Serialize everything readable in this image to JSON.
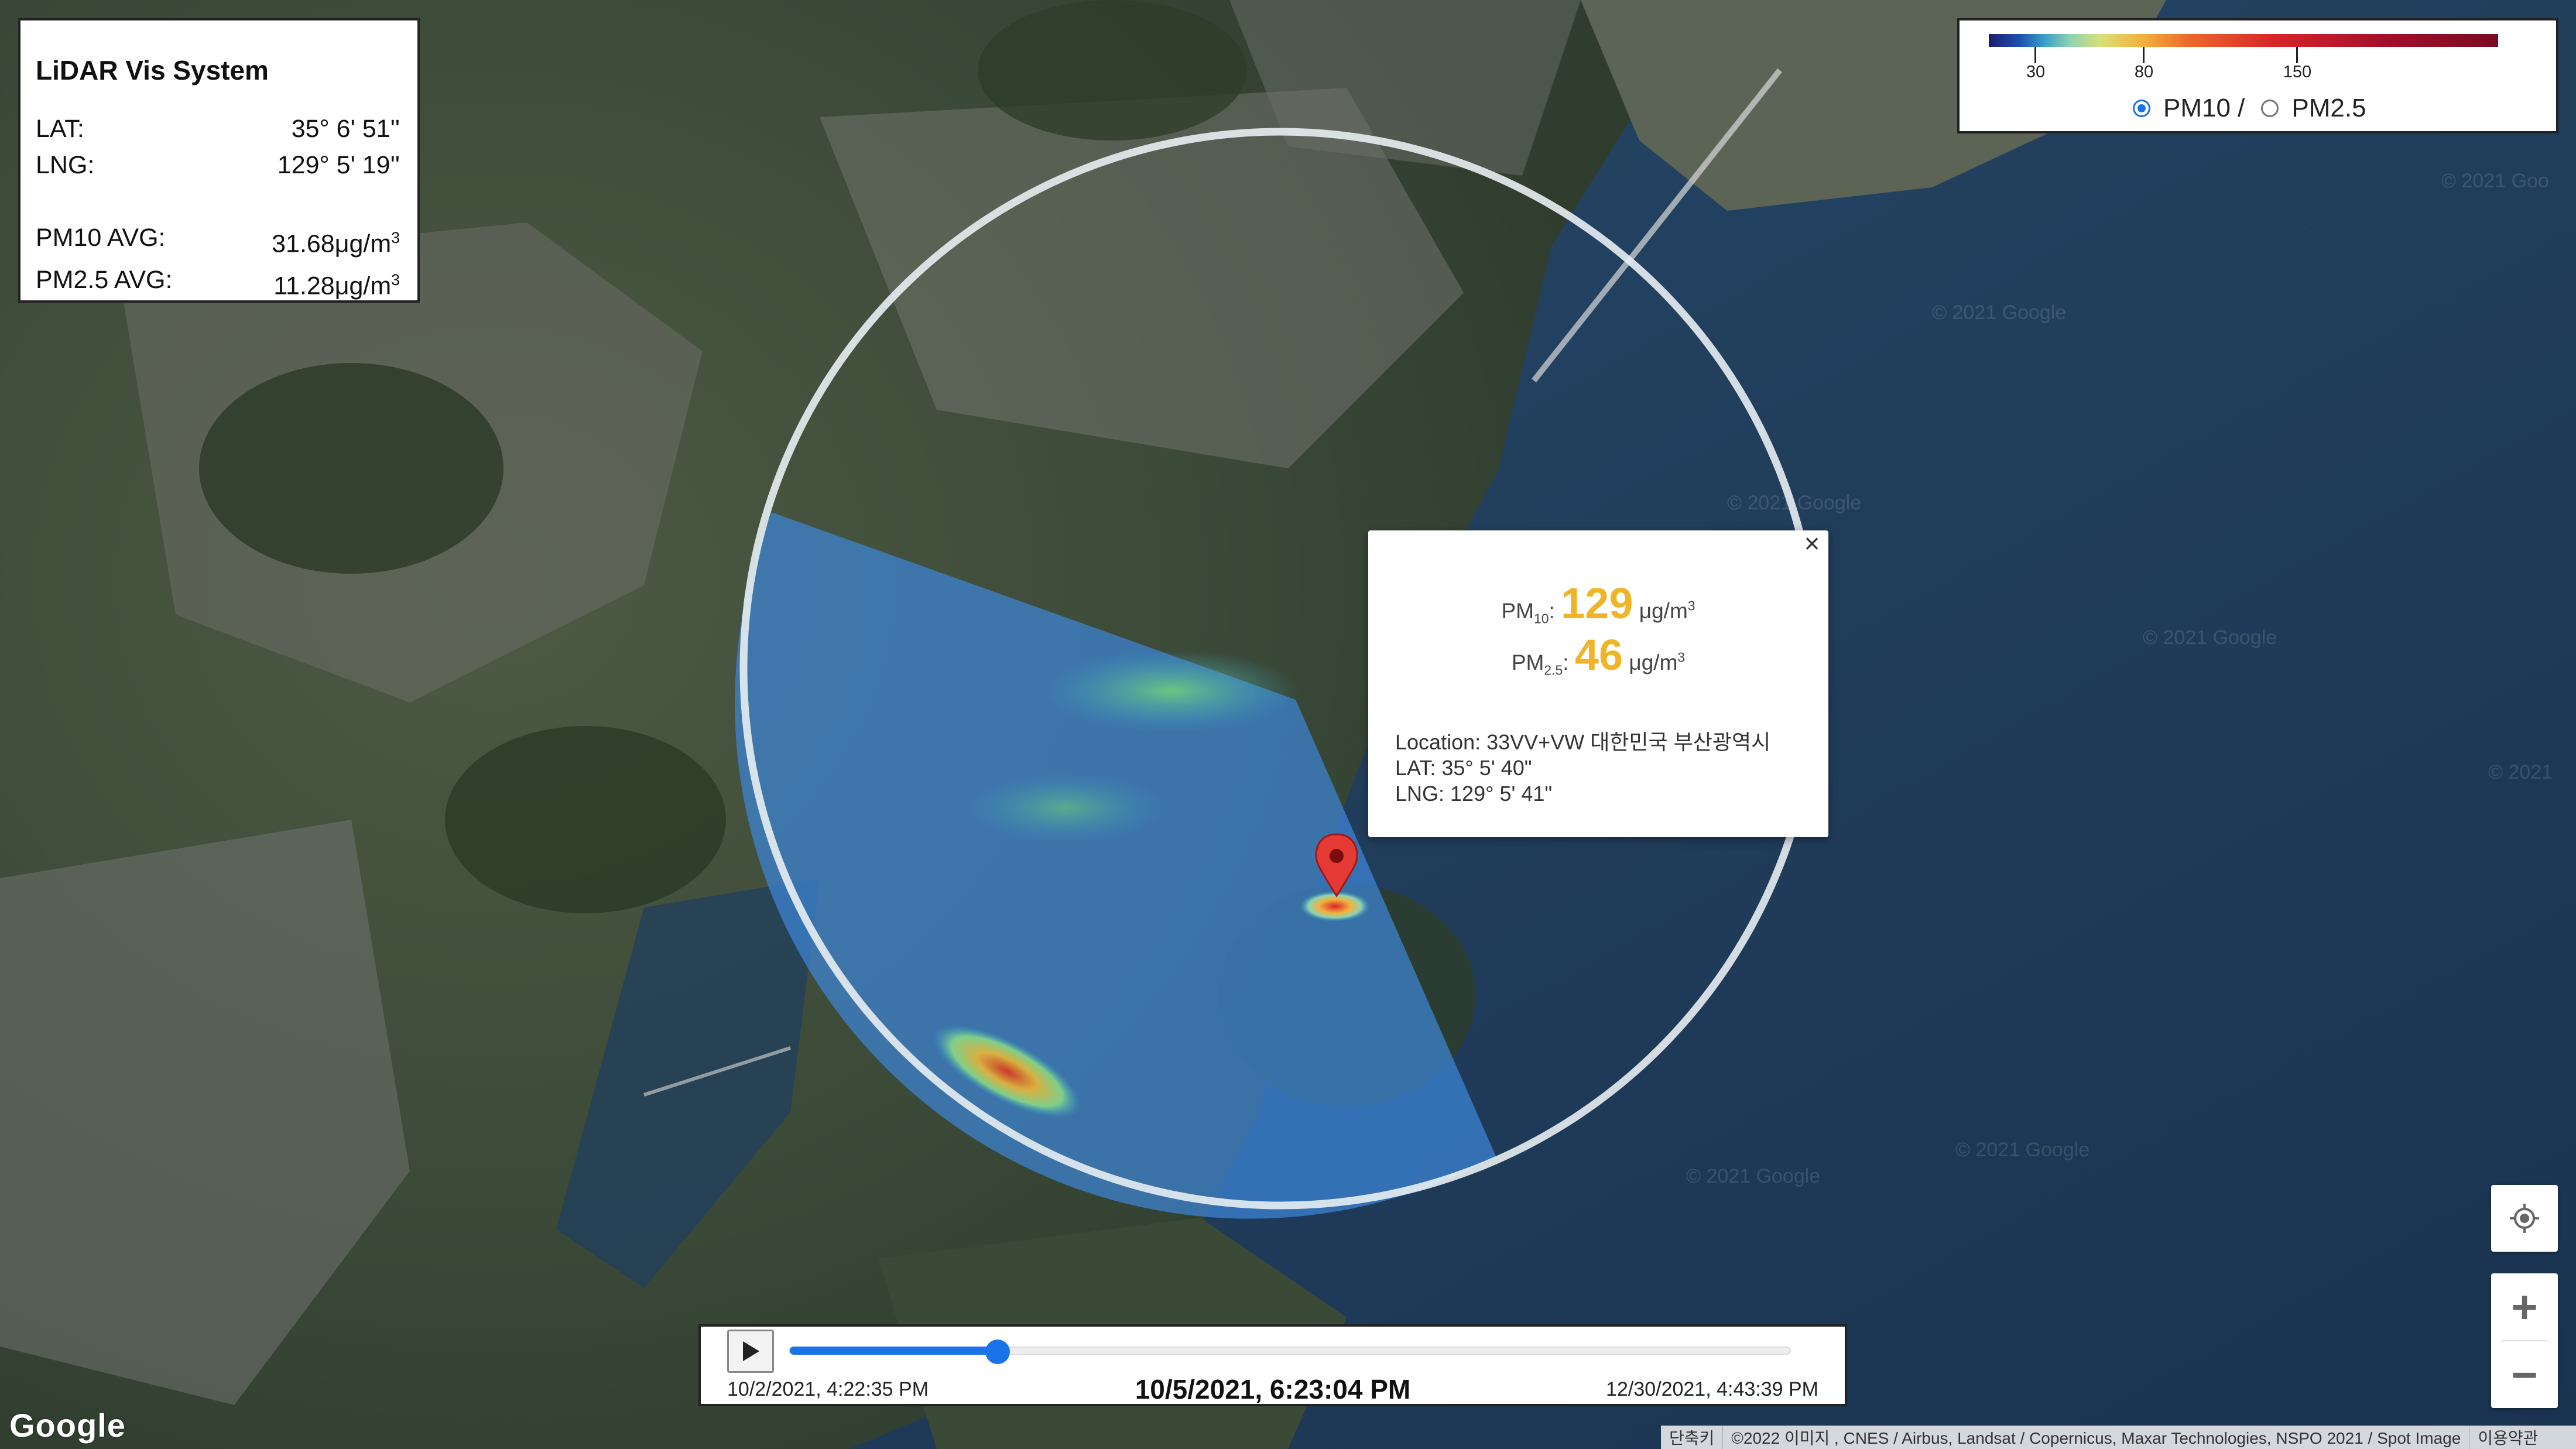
{
  "info": {
    "title": "LiDAR Vis System",
    "lat_label": "LAT:",
    "lat_value": "35° 6' 51''",
    "lng_label": "LNG:",
    "lng_value": "129° 5' 19''",
    "pm10_label": "PM10 AVG:",
    "pm10_value": "31.68μg/m",
    "pm25_label": "PM2.5 AVG:",
    "pm25_value": "11.28μg/m",
    "unit_exp": "3"
  },
  "legend": {
    "ticks": [
      "30",
      "80",
      "150"
    ],
    "options": [
      {
        "label": "PM10 /",
        "selected": true
      },
      {
        "label": "PM2.5",
        "selected": false
      }
    ]
  },
  "popup": {
    "close_label": "×",
    "pm10_prefix": "PM",
    "pm10_sub": "10",
    "pm10_value": "129",
    "pm25_prefix": "PM",
    "pm25_sub": "2.5",
    "pm25_value": "46",
    "unit": "μg/m",
    "unit_exp": "3",
    "location": "Location: 33VV+VW 대한민국 부산광역시",
    "lat": "LAT: 35° 5' 40\"",
    "lng": "LNG: 129° 5' 41\""
  },
  "timeline": {
    "start": "10/2/2021, 4:22:35 PM",
    "current": "10/5/2021, 6:23:04 PM",
    "end": "12/30/2021, 4:43:39 PM",
    "progress": 0.208
  },
  "map": {
    "watermark": "© 2021 Google",
    "logo": "Google",
    "attribution": [
      "단축키",
      "©2022 이미지 , CNES / Airbus, Landsat / Copernicus, Maxar Technologies, NSPO 2021 / Spot Image",
      "이용약관"
    ]
  },
  "colors": {
    "accent": "#1a73e8",
    "pm_value": "#f0b429",
    "marker": "#e53935"
  }
}
